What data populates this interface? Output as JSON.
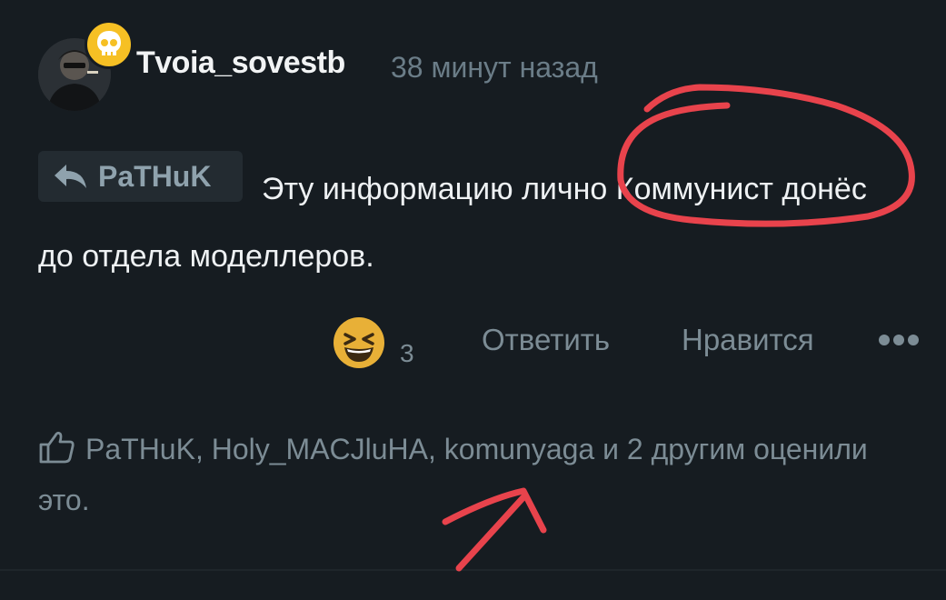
{
  "comment": {
    "author": "Tvoia_sovestb",
    "timestamp": "38 минут назад",
    "reply_to": "PaTHuK",
    "text": "Эту информацию лично Коммунист донёс до отдела моделлеров.",
    "reaction": {
      "icon": "laughing-emoji-icon",
      "count": "3"
    },
    "actions": {
      "reply_label": "Ответить",
      "like_label": "Нравится",
      "more_icon": "more-dots-icon"
    },
    "likes_text": "PaTHuK, Holy_MACJluHA, komunyaga и 2 другим оценили это."
  },
  "colors": {
    "background": "#161c21",
    "badge": "#f6c024",
    "muted_text": "#7c8c95",
    "annotation_red": "#e8434c"
  }
}
